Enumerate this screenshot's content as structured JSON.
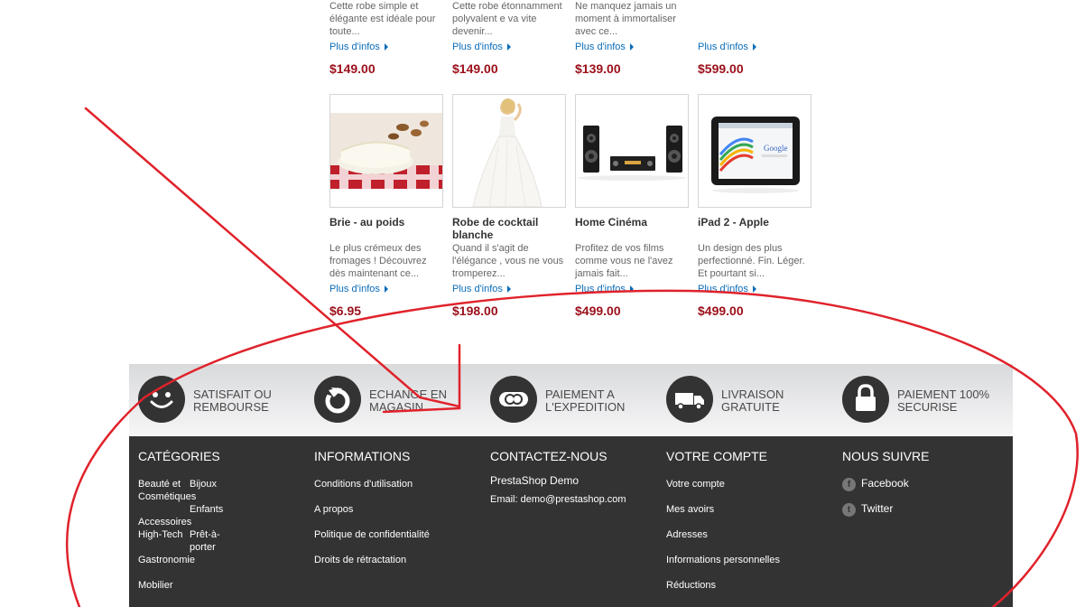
{
  "products_top": [
    {
      "desc": "Cette robe simple et élégante est idéale pour toute...",
      "more": "Plus d'infos",
      "price": "$149.00"
    },
    {
      "desc": "Cette robe étonnamment polyvalent e va vite devenir...",
      "more": "Plus d'infos",
      "price": "$149.00"
    },
    {
      "desc": "Ne manquez jamais un moment à immortaliser avec ce...",
      "more": "Plus d'infos",
      "price": "$139.00"
    },
    {
      "desc": "",
      "more": "Plus d'infos",
      "price": "$599.00"
    }
  ],
  "products_bottom": [
    {
      "name": "Brie - au poids",
      "desc": "Le plus crémeux des fromages ! Découvrez dès maintenant ce...",
      "more": "Plus d'infos",
      "price": "$6.95"
    },
    {
      "name": "Robe de cocktail blanche",
      "desc": "Quand il s'agit de l'élégance , vous ne vous tromperez...",
      "more": "Plus d'infos",
      "price": "$198.00"
    },
    {
      "name": "Home Cinéma",
      "desc": "Profitez de vos films comme vous ne l'avez jamais fait...",
      "more": "Plus d'infos",
      "price": "$499.00"
    },
    {
      "name": "iPad 2 - Apple",
      "desc": "Un design des plus perfectionné. Fin. Léger. Et pourtant si...",
      "more": "Plus d'infos",
      "price": "$499.00"
    }
  ],
  "reassurance": [
    {
      "line1": "SATISFAIT OU",
      "line2": "REMBOURSE",
      "icon": "smiley-icon"
    },
    {
      "line1": "ECHANGE EN",
      "line2": "MAGASIN",
      "icon": "refresh-icon"
    },
    {
      "line1": "PAIEMENT A",
      "line2": "L'EXPEDITION",
      "icon": "cash-icon"
    },
    {
      "line1": "LIVRAISON",
      "line2": "GRATUITE",
      "icon": "truck-icon"
    },
    {
      "line1": "PAIEMENT 100%",
      "line2": "SECURISE",
      "icon": "padlock-icon"
    }
  ],
  "footer": {
    "categories": {
      "title": "CATÉGORIES",
      "items": [
        "Beauté et",
        "Cosmétiques",
        "Bijoux",
        "Enfants",
        "Accessoires",
        "High-Tech",
        "Prêt-à-",
        "porter",
        "Gastronomie",
        "Mobilier"
      ]
    },
    "informations": {
      "title": "INFORMATIONS",
      "items": [
        "Conditions d'utilisation",
        "A propos",
        "Politique de confidentialité",
        "Droits de rétractation"
      ]
    },
    "contact": {
      "title": "CONTACTEZ-NOUS",
      "company": "PrestaShop Demo",
      "email_label": "Email:",
      "email": "demo@prestashop.com"
    },
    "account": {
      "title": "VOTRE COMPTE",
      "items": [
        "Votre compte",
        "Mes avoirs",
        "Adresses",
        "Informations personnelles",
        "Réductions"
      ]
    },
    "follow": {
      "title": "NOUS SUIVRE",
      "items": [
        "Facebook",
        "Twitter"
      ]
    }
  },
  "colors": {
    "price": "#9b0f1a",
    "link": "#0a6cb7",
    "footer_bg": "#333333",
    "annotation": "#e0222b"
  }
}
